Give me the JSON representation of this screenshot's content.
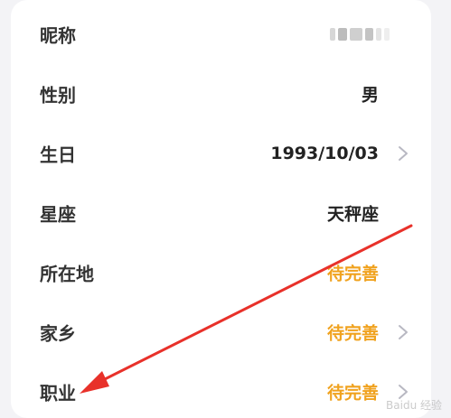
{
  "profile": {
    "rows": [
      {
        "label": "昵称",
        "value": "",
        "masked": true,
        "chevron": false
      },
      {
        "label": "性别",
        "value": "男",
        "chevron": false,
        "pending": false
      },
      {
        "label": "生日",
        "value": "1993/10/03",
        "chevron": true,
        "pending": false
      },
      {
        "label": "星座",
        "value": "天秤座",
        "chevron": false,
        "pending": false
      },
      {
        "label": "所在地",
        "value": "待完善",
        "chevron": false,
        "pending": true
      },
      {
        "label": "家乡",
        "value": "待完善",
        "chevron": true,
        "pending": true
      },
      {
        "label": "职业",
        "value": "待完善",
        "chevron": true,
        "pending": true
      }
    ]
  },
  "colors": {
    "pending": "#f0a21e",
    "arrow": "#e8312a",
    "chevron": "#b8b8c2"
  },
  "watermark": "Baidu 经验"
}
